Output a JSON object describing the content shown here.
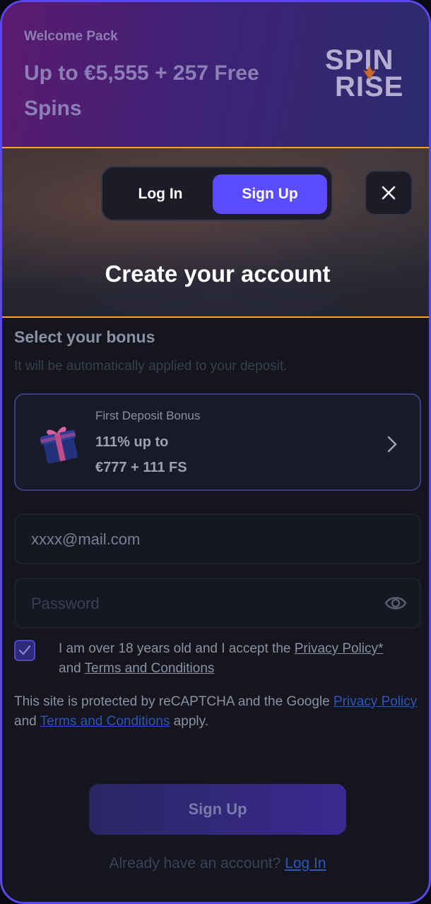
{
  "banner": {
    "subtitle": "Welcome Pack",
    "title": "Up to €5,555 + 257 Free Spins",
    "logo_top": "SPIN",
    "logo_bottom": "RISE"
  },
  "auth_tabs": {
    "login_label": "Log In",
    "signup_label": "Sign Up",
    "active": "Sign Up"
  },
  "close_icon": "close-icon",
  "page_title": "Create your account",
  "bonus": {
    "heading": "Select your bonus",
    "subheading": "It will be automatically applied to your deposit.",
    "card_label": "First Deposit Bonus",
    "card_line1": "111% up to",
    "card_line2": "€777 + 111 FS"
  },
  "form": {
    "email_value": "xxxx@mail.com",
    "password_placeholder": "Password",
    "terms_checked": true,
    "consent_prefix": "I am over 18 years old and I accept the ",
    "consent_privacy_link": "Privacy Policy*",
    "consent_and": " and ",
    "consent_terms_link": "Terms and Conditions",
    "recaptcha_prefix": "This site is protected by reCAPTCHA and the Google ",
    "recaptcha_privacy_link": "Privacy Policy",
    "recaptcha_and": " and ",
    "recaptcha_terms_link": "Terms and Conditions",
    "recaptcha_suffix": " apply.",
    "submit_label": "Sign Up"
  },
  "footer": {
    "prompt": "Already have an account? ",
    "login_link": "Log In"
  },
  "colors": {
    "accent": "#5b4cff",
    "border_accent": "#5b46f0",
    "divider": "#f0a53c",
    "link": "#2f55b8"
  }
}
